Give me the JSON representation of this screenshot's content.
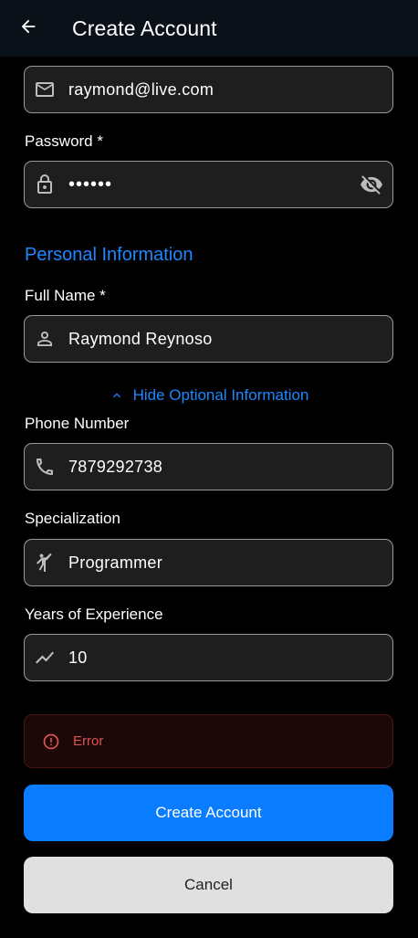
{
  "appbar": {
    "title": "Create Account",
    "back_icon": "arrow-left-icon"
  },
  "form": {
    "email": {
      "value": "raymond@live.com",
      "icon": "mail-icon"
    },
    "password": {
      "label": "Password *",
      "value": "••••••",
      "icon": "lock-icon",
      "toggle_icon": "eye-off-icon"
    },
    "personal_section_title": "Personal Information",
    "full_name": {
      "label": "Full Name *",
      "value": "Raymond Reynoso",
      "icon": "person-icon"
    },
    "optional_toggle": {
      "label": "Hide Optional Information",
      "icon": "chevron-up-icon"
    },
    "phone": {
      "label": "Phone Number",
      "value": "7879292738",
      "icon": "phone-icon"
    },
    "specialization": {
      "label": "Specialization",
      "value": "Programmer",
      "icon": "karate-icon"
    },
    "experience": {
      "label": "Years of Experience",
      "value": "10",
      "icon": "trending-icon"
    }
  },
  "error": {
    "text": "Error",
    "icon": "error-circle-icon"
  },
  "buttons": {
    "create": "Create Account",
    "cancel": "Cancel"
  },
  "colors": {
    "accent": "#1e88ff",
    "primary_button": "#0a7cff",
    "error_text": "#e05252",
    "field_bg": "#1e1e1e",
    "appbar_bg": "#0b1118"
  }
}
